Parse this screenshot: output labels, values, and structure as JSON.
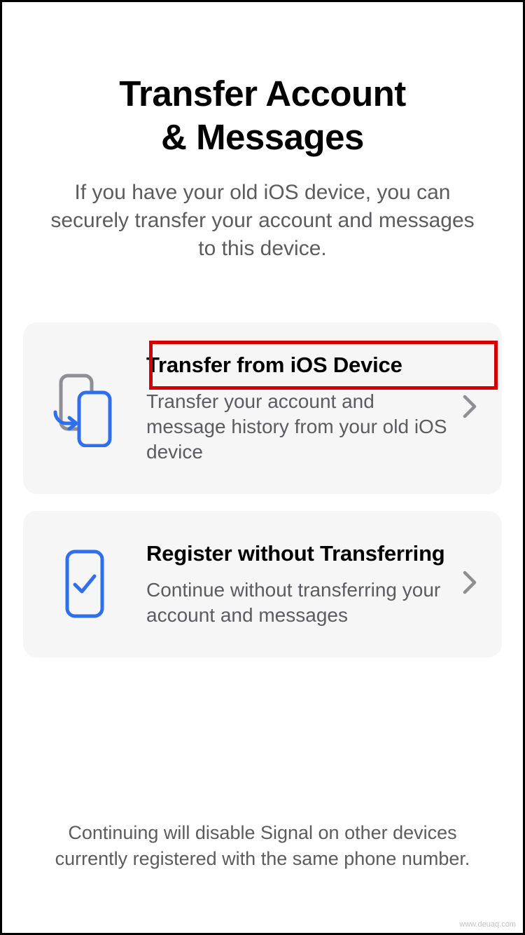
{
  "header": {
    "title_line1": "Transfer Account",
    "title_line2": "& Messages",
    "subtitle": "If you have your old iOS device, you can securely transfer your account and messages to this device."
  },
  "options": [
    {
      "title": "Transfer from iOS Device",
      "subtitle": "Transfer your account and message history from your old iOS device"
    },
    {
      "title": "Register without Transferring",
      "subtitle": "Continue without transferring your account and messages"
    }
  ],
  "footer": {
    "note": "Continuing will disable Signal on other devices currently registered with the same phone number."
  },
  "watermark": "www.deuaq.com",
  "colors": {
    "accent": "#2F6FED",
    "accent_stroke": "#2F6FED",
    "secondary_stroke": "#8E8E93"
  }
}
